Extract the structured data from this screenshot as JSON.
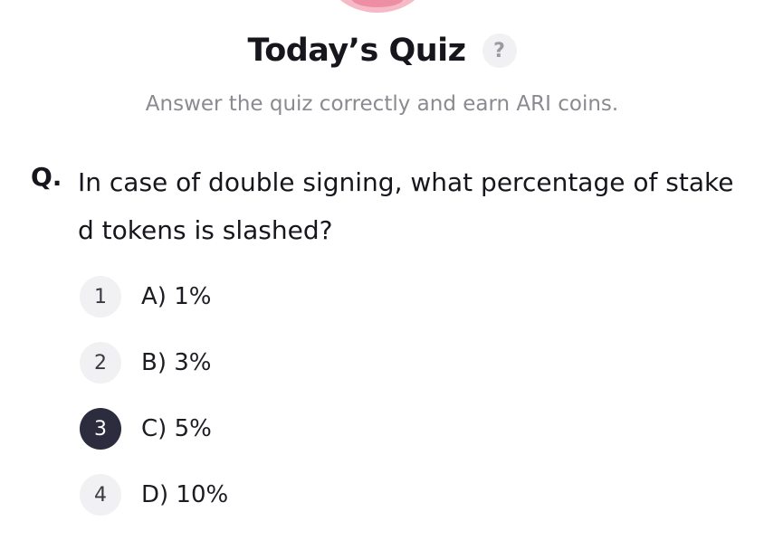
{
  "quiz": {
    "title": "Today’s Quiz",
    "help_glyph": "?",
    "subtitle": "Answer the quiz correctly and earn ARI coins."
  },
  "question": {
    "prefix": "Q.",
    "text": "In case of double signing, what percentage of stake d tokens is slashed?"
  },
  "options": [
    {
      "number": "1",
      "label": "A) 1%",
      "selected": false
    },
    {
      "number": "2",
      "label": "B) 3%",
      "selected": false
    },
    {
      "number": "3",
      "label": "C) 5%",
      "selected": true
    },
    {
      "number": "4",
      "label": "D) 10%",
      "selected": false
    }
  ],
  "colors": {
    "selected_badge": "#2b2c3d",
    "unselected_badge": "#f1f1f3",
    "header_blob": "#f6b9c6"
  }
}
